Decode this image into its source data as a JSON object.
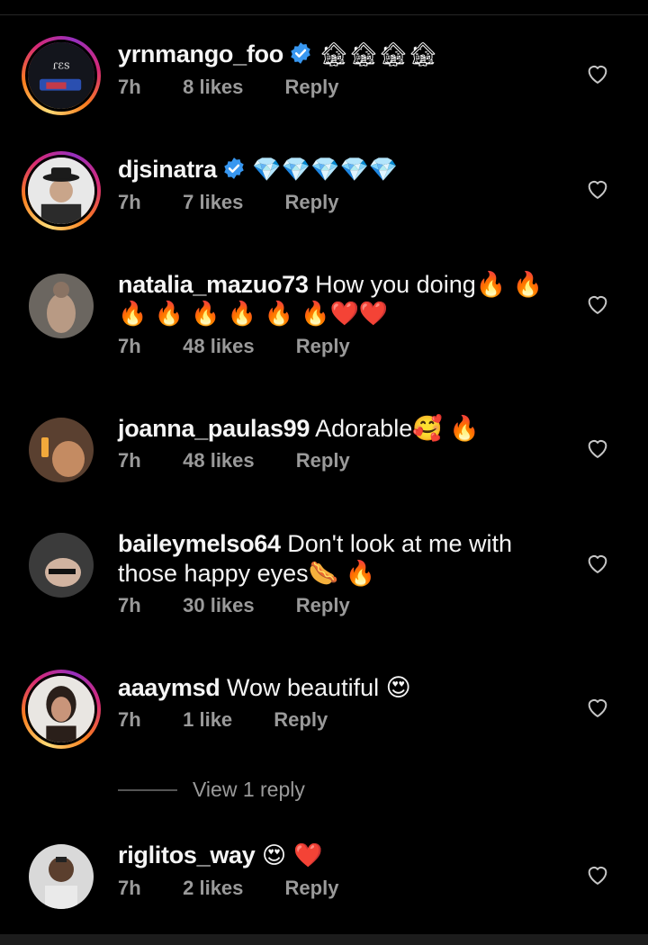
{
  "comments": [
    {
      "username": "yrnmango_foo",
      "verified": true,
      "text": "🏚🏚🏚🏚",
      "text_line2": "",
      "time": "7h",
      "likes": "8 likes",
      "reply": "Reply",
      "avatar": {
        "ring": true
      }
    },
    {
      "username": "djsinatra",
      "verified": true,
      "text": "💎💎💎💎💎",
      "text_line2": "",
      "time": "7h",
      "likes": "7 likes",
      "reply": "Reply",
      "avatar": {
        "ring": true
      }
    },
    {
      "username": "natalia_mazuo73",
      "verified": false,
      "text": "How you doing🔥 🔥",
      "text_line2": "🔥 🔥 🔥 🔥 🔥 🔥❤️❤️",
      "time": "7h",
      "likes": "48 likes",
      "reply": "Reply",
      "avatar": {
        "ring": false
      }
    },
    {
      "username": "joanna_paulas99",
      "verified": false,
      "text": "Adorable🥰 🔥",
      "text_line2": "",
      "time": "7h",
      "likes": "48 likes",
      "reply": "Reply",
      "avatar": {
        "ring": false
      }
    },
    {
      "username": "baileymelso64",
      "verified": false,
      "text": "Don't look at me with",
      "text_line2": "those happy eyes🌭 🔥",
      "time": "7h",
      "likes": "30 likes",
      "reply": "Reply",
      "avatar": {
        "ring": false
      }
    },
    {
      "username": "aaaymsd",
      "verified": false,
      "text": "Wow beautiful 😍",
      "text_line2": "",
      "time": "7h",
      "likes": "1 like",
      "reply": "Reply",
      "avatar": {
        "ring": true
      }
    },
    {
      "username": "riglitos_way",
      "verified": false,
      "text": "😍 ❤️",
      "text_line2": "",
      "time": "7h",
      "likes": "2 likes",
      "reply": "Reply",
      "avatar": {
        "ring": false
      }
    }
  ],
  "view_replies": {
    "label": "View 1 reply"
  },
  "colors": {
    "background": "#000000",
    "text": "#f5f5f5",
    "meta": "#9a9a9a",
    "verified": "#3897f0"
  },
  "icons": {
    "like": "heart-outline-icon",
    "verified": "verified-badge-icon"
  }
}
